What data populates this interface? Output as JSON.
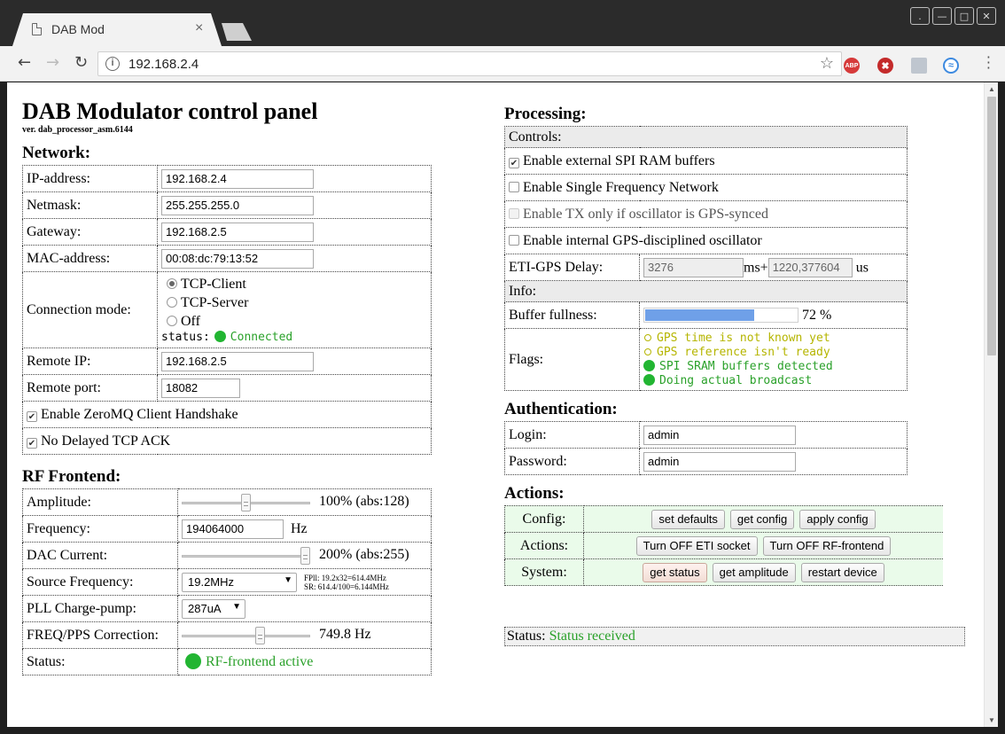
{
  "browser": {
    "tab_title": "DAB Mod",
    "tab_close": "×",
    "url": "192.168.2.4",
    "ext_abp": "ABP"
  },
  "page": {
    "title": "DAB Modulator control panel",
    "version": "ver. dab_processor_asm.6144"
  },
  "network": {
    "heading": "Network:",
    "ip_label": "IP-address:",
    "ip_value": "192.168.2.4",
    "netmask_label": "Netmask:",
    "netmask_value": "255.255.255.0",
    "gateway_label": "Gateway:",
    "gateway_value": "192.168.2.5",
    "mac_label": "MAC-address:",
    "mac_value": "00:08:dc:79:13:52",
    "conn_label": "Connection mode:",
    "conn_options": [
      "TCP-Client",
      "TCP-Server",
      "Off"
    ],
    "conn_selected": "TCP-Client",
    "status_label": "status:",
    "status_value": "Connected",
    "remote_ip_label": "Remote IP:",
    "remote_ip_value": "192.168.2.5",
    "remote_port_label": "Remote port:",
    "remote_port_value": "18082",
    "zmq_label": "Enable ZeroMQ Client Handshake",
    "zmq_checked": true,
    "tcpack_label": "No Delayed TCP ACK",
    "tcpack_checked": true
  },
  "rf": {
    "heading": "RF Frontend:",
    "amplitude_label": "Amplitude:",
    "amplitude_value": "100% (abs:128)",
    "amplitude_level": 0.5,
    "frequency_label": "Frequency:",
    "frequency_value": "194064000",
    "frequency_unit": "Hz",
    "dac_label": "DAC Current:",
    "dac_value": "200% (abs:255)",
    "dac_level": 1.0,
    "source_label": "Source Frequency:",
    "source_value": "19.2MHz",
    "source_note1": "FPll: 19.2x32=614.4MHz",
    "source_note2": "SR: 614.4/100=6.144MHz",
    "pll_label": "PLL Charge-pump:",
    "pll_value": "287uA",
    "freqcorr_label": "FREQ/PPS Correction:",
    "freqcorr_value": "749.8 Hz",
    "freqcorr_level": 0.62,
    "status_label": "Status:",
    "status_value": "RF-frontend active"
  },
  "processing": {
    "heading": "Processing:",
    "controls_header": "Controls:",
    "spi_label": "Enable external SPI RAM buffers",
    "spi_checked": true,
    "sfn_label": "Enable Single Frequency Network",
    "sfn_checked": false,
    "txgps_label": "Enable TX only if oscillator is GPS-synced",
    "txgps_checked": false,
    "gpsdo_label": "Enable internal GPS-disciplined oscillator",
    "gpsdo_checked": false,
    "delay_label": "ETI-GPS Delay:",
    "delay_ms_value": "3276",
    "delay_ms_unit": "ms+",
    "delay_us_value": "1220,377604",
    "delay_us_unit": "us",
    "info_header": "Info:",
    "buffer_label": "Buffer fullness:",
    "buffer_value": "72 %",
    "buffer_fraction": 0.72,
    "flags_label": "Flags:",
    "flags": [
      {
        "text": "GPS time is not known yet",
        "state": "off"
      },
      {
        "text": "GPS reference isn't ready",
        "state": "off"
      },
      {
        "text": "SPI SRAM buffers detected",
        "state": "on"
      },
      {
        "text": "Doing actual broadcast",
        "state": "on"
      }
    ]
  },
  "auth": {
    "heading": "Authentication:",
    "login_label": "Login:",
    "login_value": "admin",
    "password_label": "Password:",
    "password_value": "admin"
  },
  "actions": {
    "heading": "Actions:",
    "config_label": "Config:",
    "config_buttons": [
      "set defaults",
      "get config",
      "apply config"
    ],
    "actions_label": "Actions:",
    "actions_buttons": [
      "Turn OFF ETI socket",
      "Turn OFF RF-frontend"
    ],
    "system_label": "System:",
    "system_buttons": [
      "get status",
      "get amplitude",
      "restart device"
    ]
  },
  "status": {
    "label": "Status:",
    "value": "Status received"
  },
  "colors": {
    "accent_green": "#22b532",
    "progress_blue": "#6fa0e8",
    "flag_off": "#b5b500"
  }
}
